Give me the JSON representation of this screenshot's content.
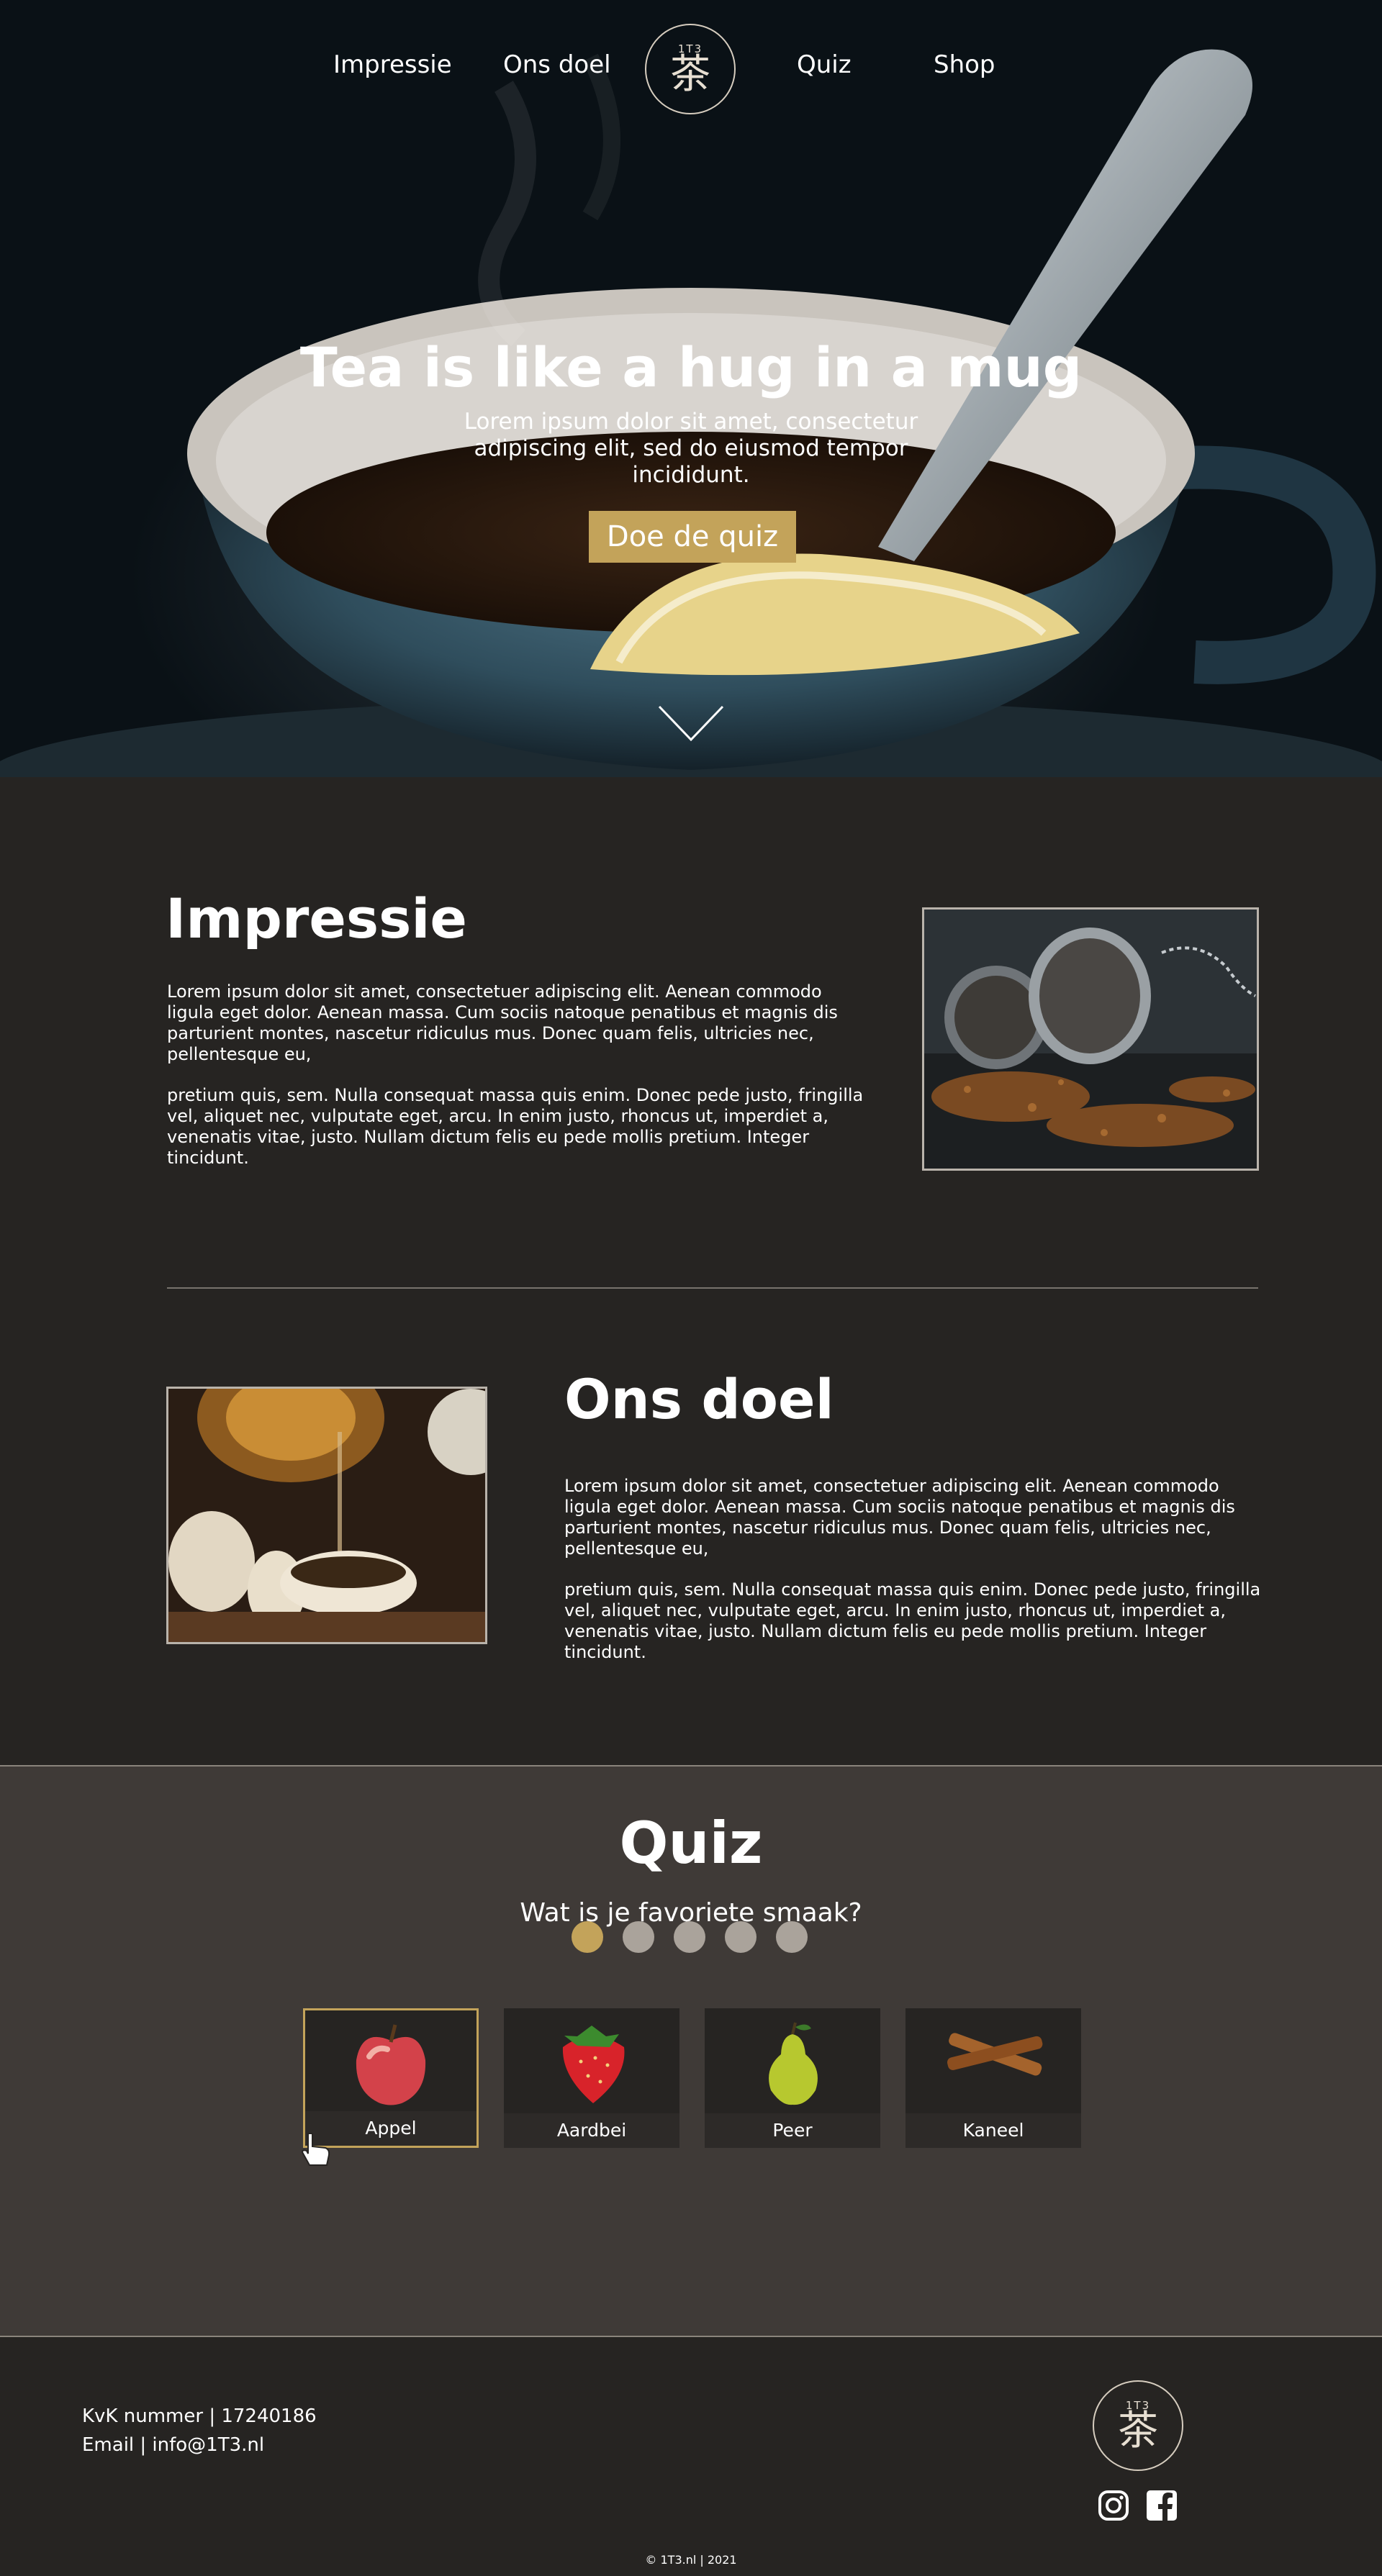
{
  "nav": {
    "items": [
      "Impressie",
      "Ons doel",
      "Quiz",
      "Shop"
    ],
    "logo": {
      "top_text": "1T3",
      "glyph": "茶"
    }
  },
  "hero": {
    "title": "Tea is like a hug in a mug",
    "subtitle": "Lorem ipsum dolor sit amet, consectetur adipiscing elit, sed do eiusmod tempor incididunt.",
    "button": "Doe de quiz",
    "scroll_icon": "chevron-down-icon"
  },
  "impressie": {
    "title": "Impressie",
    "paragraph1": "Lorem ipsum dolor sit amet, consectetuer adipiscing elit. Aenean commodo ligula eget dolor. Aenean massa. Cum sociis natoque penatibus et magnis dis parturient montes, nascetur ridiculus mus. Donec quam felis, ultricies nec, pellentesque eu,",
    "paragraph2": "pretium quis, sem. Nulla consequat massa quis enim. Donec pede justo, fringilla vel, aliquet nec, vulputate eget, arcu. In enim justo, rhoncus ut, imperdiet a, venenatis vitae, justo. Nullam dictum felis eu pede mollis pretium. Integer tincidunt."
  },
  "ons_doel": {
    "title": "Ons doel",
    "paragraph1": "Lorem ipsum dolor sit amet, consectetuer adipiscing elit. Aenean commodo ligula eget dolor. Aenean massa. Cum sociis natoque penatibus et magnis dis parturient montes, nascetur ridiculus mus. Donec quam felis, ultricies nec, pellentesque eu,",
    "paragraph2": "pretium quis, sem. Nulla consequat massa quis enim. Donec pede justo, fringilla vel, aliquet nec, vulputate eget, arcu. In enim justo, rhoncus ut, imperdiet a, venenatis vitae, justo. Nullam dictum felis eu pede mollis pretium. Integer tincidunt."
  },
  "quiz": {
    "title": "Quiz",
    "question": "Wat is je favoriete smaak?",
    "options": [
      {
        "label": "Appel",
        "icon": "apple-icon",
        "selected": true
      },
      {
        "label": "Aardbei",
        "icon": "strawberry-icon",
        "selected": false
      },
      {
        "label": "Peer",
        "icon": "pear-icon",
        "selected": false
      },
      {
        "label": "Kaneel",
        "icon": "cinnamon-icon",
        "selected": false
      }
    ],
    "current_step": 1,
    "total_steps": 5
  },
  "footer": {
    "kvk": "KvK nummer | 17240186",
    "email": "Email | info@1T3.nl",
    "copyright": "© 1T3.nl | 2021",
    "social": [
      "instagram-icon",
      "facebook-icon"
    ]
  },
  "colors": {
    "accent": "#c3a35a",
    "background": "#262422",
    "quiz_background": "#3f3a37",
    "dot_inactive": "#aaa39b"
  }
}
